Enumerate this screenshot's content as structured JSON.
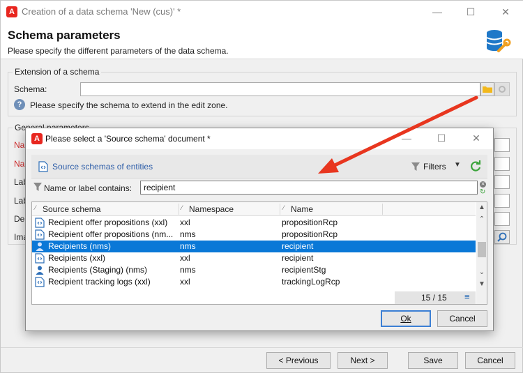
{
  "window": {
    "title": "Creation of a data schema 'New (cus)' *",
    "header_title": "Schema parameters",
    "header_subtitle": "Please specify the different parameters of the data schema."
  },
  "extension": {
    "legend": "Extension of a schema",
    "schema_label": "Schema:",
    "schema_value": "",
    "help_text": "Please specify the schema to extend in the edit zone."
  },
  "general": {
    "legend": "General parameters",
    "field_labels": [
      "Na",
      "Na",
      "Lab",
      "Lab",
      "De",
      "Ima"
    ]
  },
  "footer": {
    "previous": "< Previous",
    "next": "Next >",
    "save": "Save",
    "cancel": "Cancel"
  },
  "dialog": {
    "title": "Please select a 'Source schema' document *",
    "toolbar_link": "Source schemas of entities",
    "filters_label": "Filters",
    "search_label": "Name or label contains:",
    "search_value": "recipient",
    "columns": [
      "Source schema",
      "Namespace",
      "Name"
    ],
    "rows": [
      {
        "label": "Recipient offer propositions (xxl)",
        "ns": "xxl",
        "name": "propositionRcp",
        "icon": "schema-icon",
        "selected": false
      },
      {
        "label": "Recipient offer propositions (nm...",
        "ns": "nms",
        "name": "propositionRcp",
        "icon": "schema-icon",
        "selected": false
      },
      {
        "label": "Recipients (nms)",
        "ns": "nms",
        "name": "recipient",
        "icon": "person-icon",
        "selected": true
      },
      {
        "label": "Recipients (xxl)",
        "ns": "xxl",
        "name": "recipient",
        "icon": "schema-icon",
        "selected": false
      },
      {
        "label": "Recipients (Staging) (nms)",
        "ns": "nms",
        "name": "recipientStg",
        "icon": "person-icon",
        "selected": false
      },
      {
        "label": "Recipient tracking logs (xxl)",
        "ns": "xxl",
        "name": "trackingLogRcp",
        "icon": "schema-icon",
        "selected": false
      }
    ],
    "count": "15 / 15",
    "ok": "Ok",
    "cancel": "Cancel"
  },
  "colors": {
    "selection": "#0a78d7",
    "link": "#2d5da8",
    "arrow": "#e8361f",
    "required_label": "#d02a2a"
  }
}
